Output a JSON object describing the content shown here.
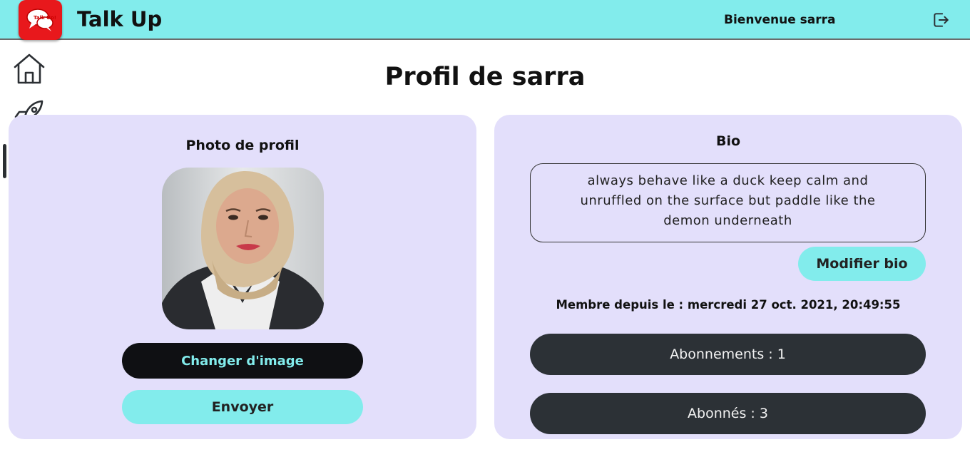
{
  "header": {
    "logo_text": "Talk Up!",
    "app_title": "Talk Up",
    "welcome_text": "Bienvenue sarra",
    "logout_icon": "logout-icon"
  },
  "sidebar": {
    "items": [
      {
        "icon": "home-icon",
        "active": false
      },
      {
        "icon": "rocket-icon",
        "active": false
      },
      {
        "icon": "user-icon",
        "active": true
      }
    ]
  },
  "page": {
    "title": "Profil de sarra"
  },
  "photo_card": {
    "heading": "Photo de profil",
    "change_button": "Changer d'image",
    "send_button": "Envoyer"
  },
  "bio_card": {
    "heading": "Bio",
    "bio_text": "always behave like a duck keep calm and unruffled on the surface but paddle like the demon underneath",
    "edit_button": "Modifier bio",
    "member_since": "Membre depuis le : mercredi 27 oct. 2021, 20:49:55",
    "following_button": "Abonnements : 1",
    "followers_button": "Abonnés : 3"
  },
  "colors": {
    "accent": "#82ecec",
    "card_bg": "#e3dffb",
    "dark_button": "#0f1013",
    "stat_button": "#2c3136",
    "logo_red": "#e8181c"
  }
}
